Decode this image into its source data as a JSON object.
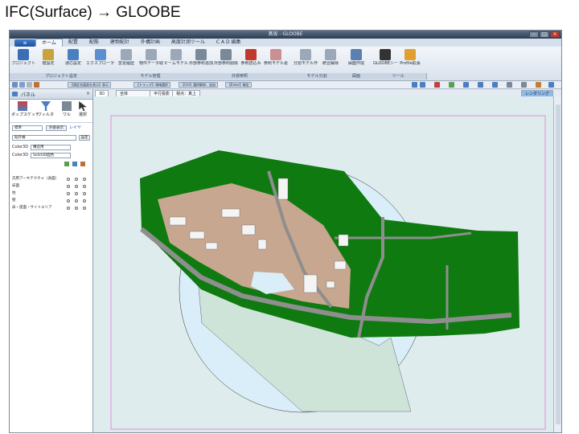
{
  "slide": {
    "title": "IFC(Surface) → GLOOBE"
  },
  "window": {
    "title": "髙坂 - GLOOBE",
    "minimize": "–",
    "maximize": "□",
    "close": "×"
  },
  "menu": {
    "app_button": "≡",
    "tabs": [
      "ホーム",
      "配置",
      "配筋",
      "建物配計",
      "外構計画",
      "高度計測ツール",
      "C A D 編集"
    ]
  },
  "ribbon": {
    "buttons": [
      {
        "label": "プロジェクト",
        "icon": "project-icon",
        "color": "#3a6fb5"
      },
      {
        "label": "階設定",
        "icon": "floor-icon",
        "color": "#c9a43c"
      },
      {
        "label": "通芯設定",
        "icon": "grid-icon",
        "color": "#4a7fc0"
      },
      {
        "label": "エクスプローラー",
        "icon": "explorer-icon",
        "color": "#5b8fd0"
      },
      {
        "label": "変更履歴",
        "icon": "history-icon",
        "color": "#9aa8b8"
      },
      {
        "label": "物件データ取込",
        "icon": "import-icon",
        "color": "#9aa8b8"
      },
      {
        "label": "ビームモデル更新",
        "icon": "model-icon",
        "color": "#9aa8b8"
      },
      {
        "label": "外部参照追加",
        "icon": "ref-add-icon",
        "color": "#7a8898"
      },
      {
        "label": "外部参照削除",
        "icon": "ref-delete-icon",
        "color": "#7a8898"
      },
      {
        "label": "参照読込み",
        "icon": "ref-load-icon",
        "color": "#c0392b"
      },
      {
        "label": "参照モデル更新",
        "icon": "ref-update-icon",
        "color": "#c89090"
      },
      {
        "label": "分割モデル作成",
        "icon": "split-icon",
        "color": "#9aa8b8"
      },
      {
        "label": "統合解除",
        "icon": "merge-icon",
        "color": "#9aa8b8"
      },
      {
        "label": "図面作成",
        "icon": "drawing-icon",
        "color": "#5b7fb0"
      },
      {
        "label": "GLOOBEシート",
        "icon": "sheet-icon",
        "color": "#333333"
      },
      {
        "label": "Profile拡張",
        "icon": "profile-icon",
        "color": "#e0a030"
      }
    ],
    "groups": [
      "プロジェクト設定",
      "モデル管理",
      "外部参照",
      "モデル分割",
      "図面",
      "ツール"
    ]
  },
  "quickbar": {
    "buttons": [
      "【規定名図面を表示】表示",
      "【ドラッグ】領域選択",
      "【Ctrl】選択解除、追加",
      "【Enter】確定"
    ]
  },
  "left_panel": {
    "title": "パネル",
    "pin": "×",
    "tools": [
      "ポップスケッチ",
      "フィルタ",
      "ワル",
      "選択"
    ],
    "filter_label": "標準",
    "filter_btn": "外部表示",
    "layer_link": "レイヤ",
    "search_value": "既存棟",
    "search_btn": "設定",
    "color3d_label": "Color3D",
    "color3d_value": "構造用",
    "solid3d_label": "Color3D",
    "solid3d_value": "Solid3D面色",
    "layers": [
      {
        "name": "汎用アーキテクチャ（表面）"
      },
      {
        "name": "床面"
      },
      {
        "name": "柱"
      },
      {
        "name": "壁"
      },
      {
        "name": "床・座面・サイトエリア"
      }
    ]
  },
  "view_tabs": [
    "3D",
    "全体",
    "平行投影",
    "視点：真上"
  ],
  "view_tab_right": "レンダリング",
  "colors": {
    "grass": "#0e7a10",
    "road": "#8e8e8e",
    "plaza": "#c7a78f",
    "water": "#d9eef8",
    "zone": "#cfe4d8",
    "border": "#e29be0"
  }
}
